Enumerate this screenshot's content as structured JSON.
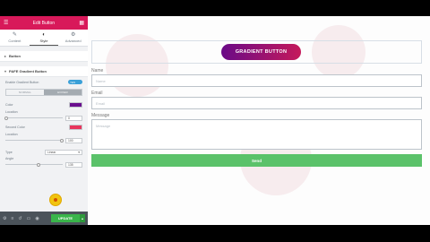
{
  "panel": {
    "title": "Edit Button",
    "tabs": [
      {
        "label": "Content",
        "icon": "pencil-icon"
      },
      {
        "label": "Style",
        "icon": "half-circle-icon"
      },
      {
        "label": "Advanced",
        "icon": "gear-icon"
      }
    ],
    "section_collapsed": "Button",
    "section_open": "PAFE Gradient Button",
    "enable_label": "Enable Gradient Button",
    "toggle_value": "YES",
    "modes": [
      "NORMAL",
      "HOVER"
    ],
    "color_label": "Color",
    "color_value": "#6a0f8e",
    "location_label": "Location",
    "location_value": "0",
    "second_color_label": "Second Color",
    "second_color_value": "#e8365d",
    "location2_label": "Location",
    "location2_value": "100",
    "type_label": "Type",
    "type_value": "Linear",
    "angle_label": "Angle",
    "angle_value": "135"
  },
  "footer": {
    "update_label": "UPDATE"
  },
  "preview": {
    "gradient_button_label": "GRADIENT BUTTON",
    "form": {
      "name_label": "Name",
      "name_placeholder": "Name",
      "email_label": "Email",
      "email_placeholder": "Email",
      "message_label": "Message",
      "message_placeholder": "Message",
      "send_label": "Send"
    }
  },
  "colors": {
    "header": "#d8195a",
    "send": "#5bc26a",
    "update": "#39b54a",
    "gradient_start": "#6a0a87",
    "gradient_end": "#c51a5b"
  }
}
